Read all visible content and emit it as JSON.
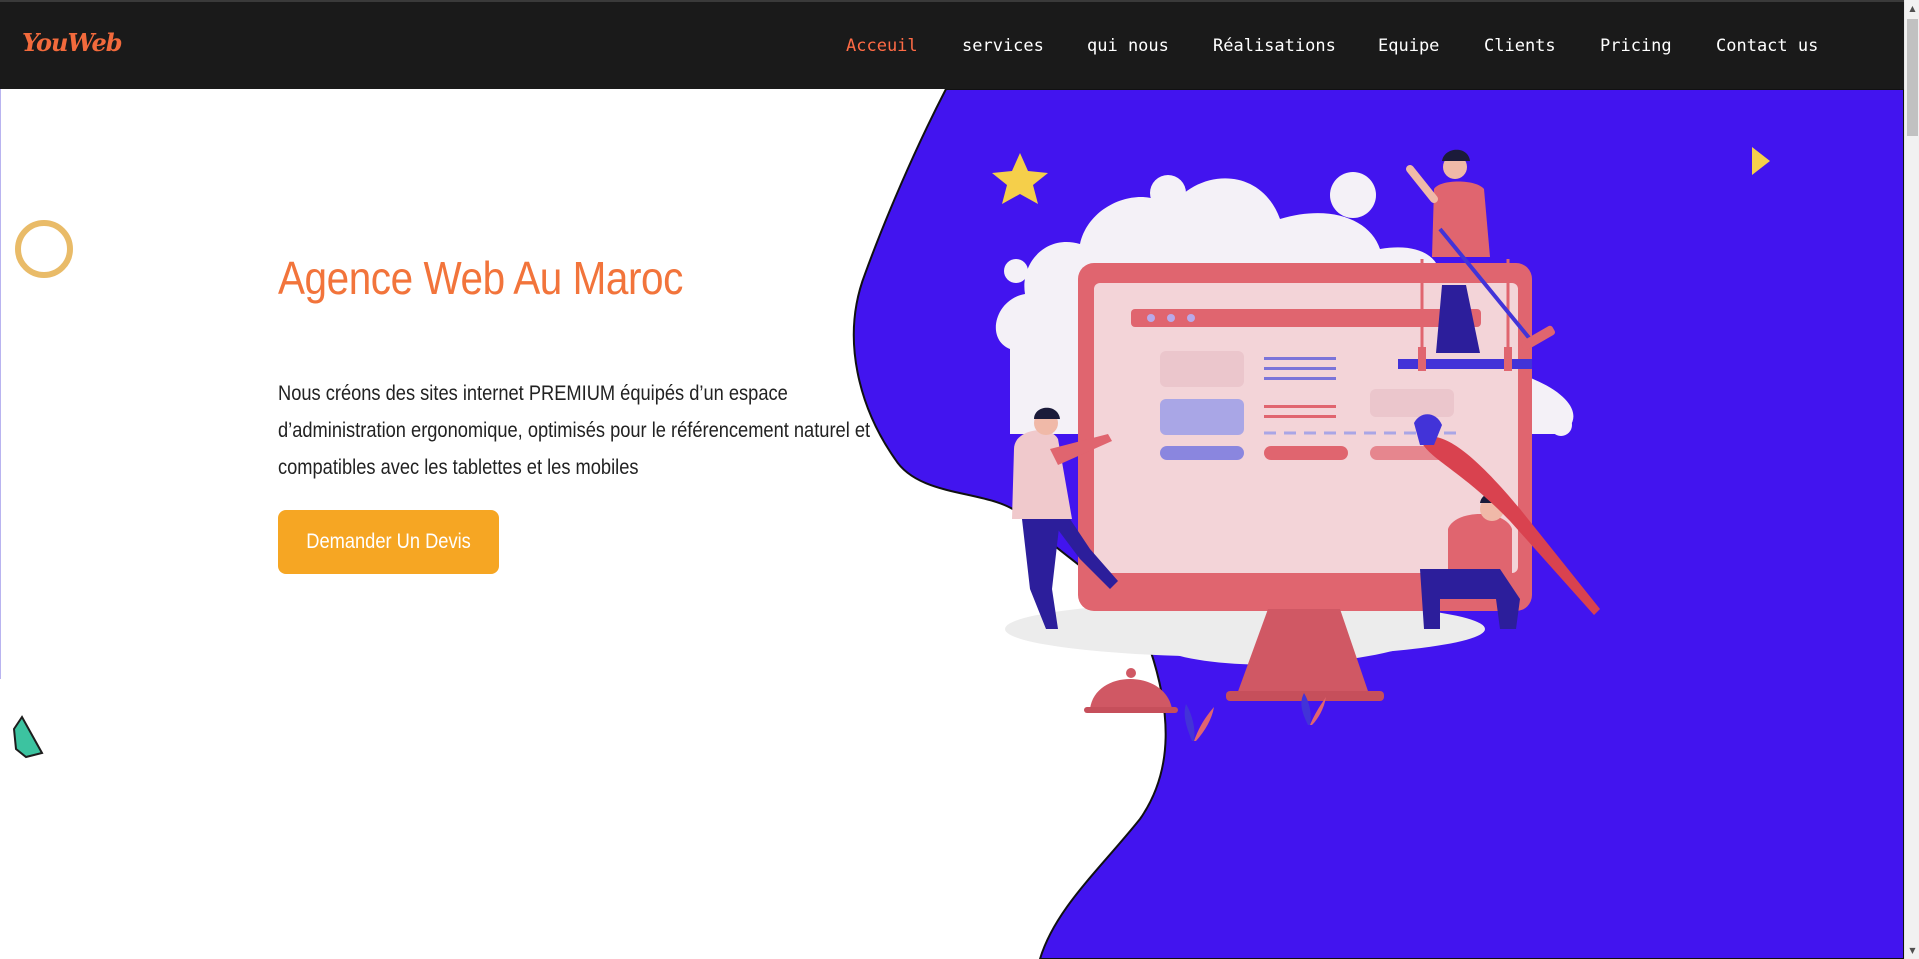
{
  "brand": {
    "logo": "YouWeb"
  },
  "nav": {
    "items": [
      {
        "label": "Acceuil",
        "active": true
      },
      {
        "label": "services",
        "active": false
      },
      {
        "label": "qui nous",
        "active": false
      },
      {
        "label": "Réalisations",
        "active": false
      },
      {
        "label": "Equipe",
        "active": false
      },
      {
        "label": "Clients",
        "active": false
      },
      {
        "label": "Pricing",
        "active": false
      },
      {
        "label": "Contact us",
        "active": false
      }
    ]
  },
  "hero": {
    "title": "Agence Web Au Maroc",
    "description": "Nous créons des sites internet PREMIUM équipés d’un espace d’administration ergonomique, optimisés pour le référencement naturel et compatibles avec les tablettes et les mobiles",
    "cta_label": "Demander Un Devis",
    "illustration": "web-design-team-illustration"
  },
  "colors": {
    "navbar_bg": "#1a1a1a",
    "accent": "#ff6b45",
    "title": "#f2743b",
    "cta": "#f6a623",
    "blob": "#4214ef",
    "monitor": "#e0656f"
  }
}
